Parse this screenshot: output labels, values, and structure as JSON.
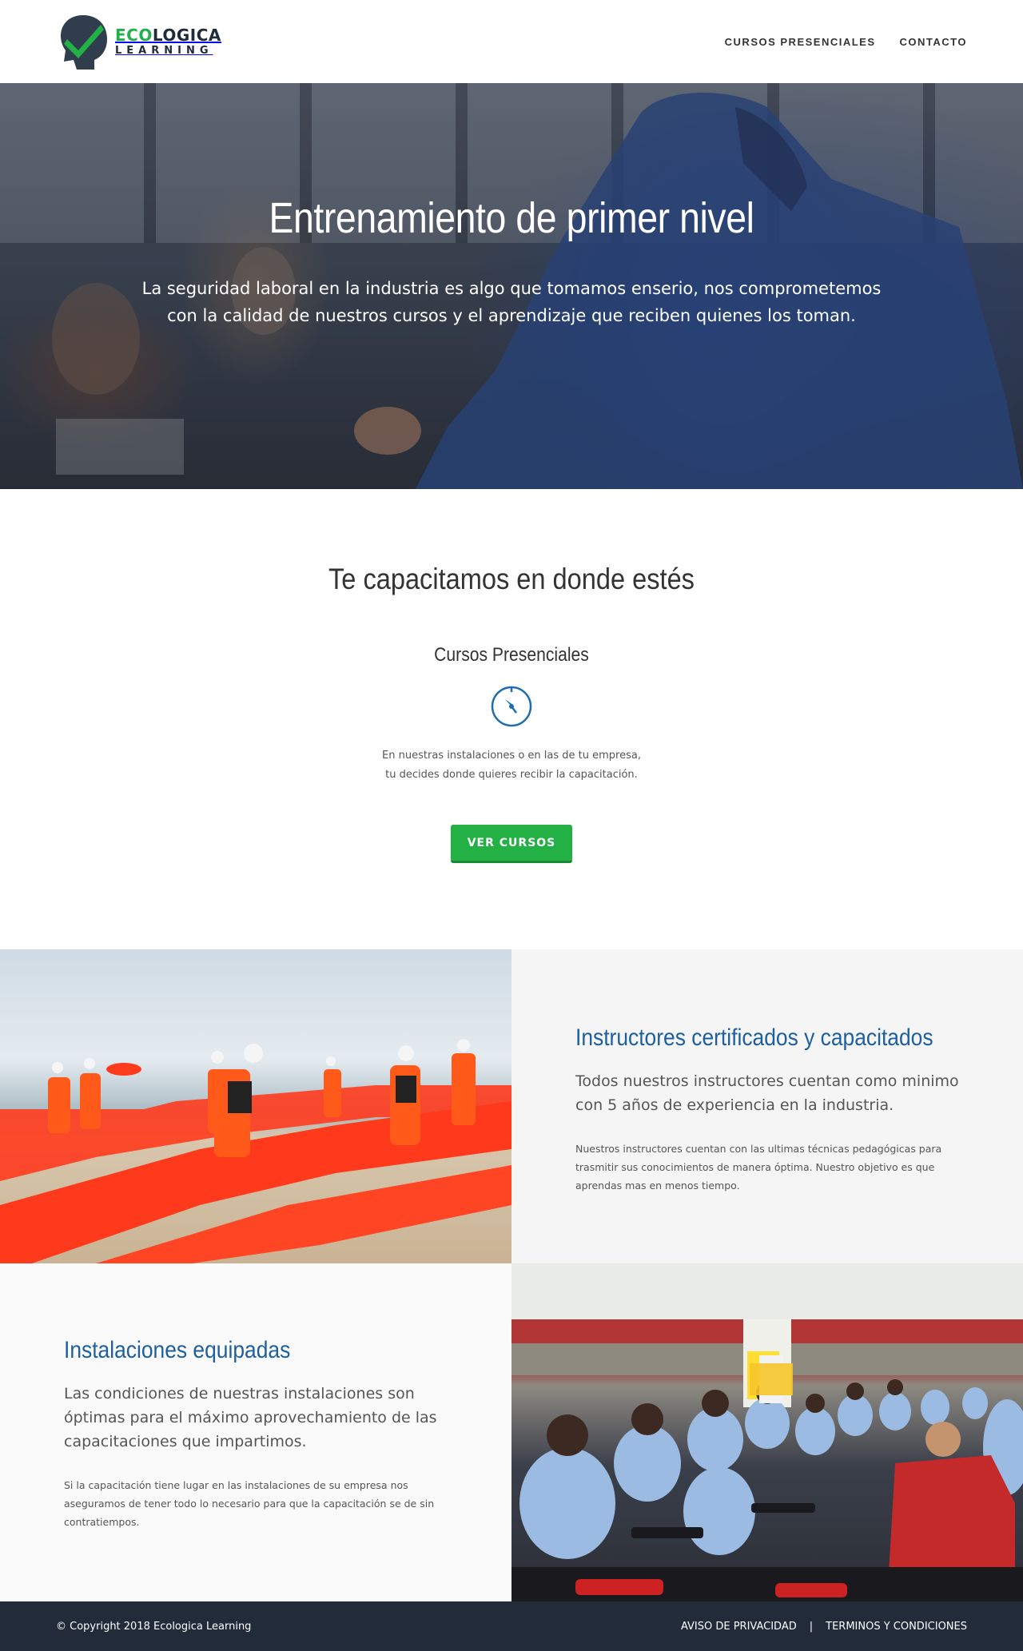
{
  "header": {
    "logo": {
      "line1_a": "ECO",
      "line1_b": "LOGICA",
      "line2": "LEARNING"
    },
    "nav": [
      {
        "label": "CURSOS PRESENCIALES"
      },
      {
        "label": "CONTACTO"
      }
    ]
  },
  "hero": {
    "title": "Entrenamiento de primer nivel",
    "text": "La seguridad laboral en la industria es algo que tomamos enserio, nos comprometemos con la calidad de nuestros cursos y el aprendizaje que reciben quienes los toman."
  },
  "section": {
    "title": "Te capacitamos en donde estés",
    "course": {
      "title": "Cursos Presenciales",
      "icon": "clock-icon",
      "desc_line1": "En nuestras instalaciones o en las de tu empresa,",
      "desc_line2": "tu decides donde quieres recibir la capacitación.",
      "button": "VER CURSOS"
    }
  },
  "features": [
    {
      "title": "Instructores certificados y capacitados",
      "lead": "Todos nuestros instructores cuentan como minimo con 5 años de experiencia en la industria.",
      "text": "Nuestros instructores cuentan con las ultimas técnicas pedagógicas para trasmitir sus conocimientos de manera óptima. Nuestro objetivo es que aprendas mas en menos tiempo."
    },
    {
      "title": "Instalaciones equipadas",
      "lead": "Las condiciones de nuestras instalaciones son óptimas para el máximo aprovechamiento de las capacitaciones que impartimos.",
      "text": "Si la capacitación tiene lugar en las instalaciones de su empresa nos aseguramos de tener todo lo necesario para que la capacitación se de sin contratiempos."
    }
  ],
  "footer": {
    "copyright": "© Copyright 2018 Ecologica Learning",
    "links": [
      {
        "label": "AVISO DE PRIVACIDAD"
      },
      {
        "label": "TERMINOS Y CONDICIONES"
      }
    ],
    "separator": "|"
  },
  "colors": {
    "accent_green": "#23b045",
    "title_blue": "#1e5fa0",
    "footer_bg": "#222b3a"
  }
}
